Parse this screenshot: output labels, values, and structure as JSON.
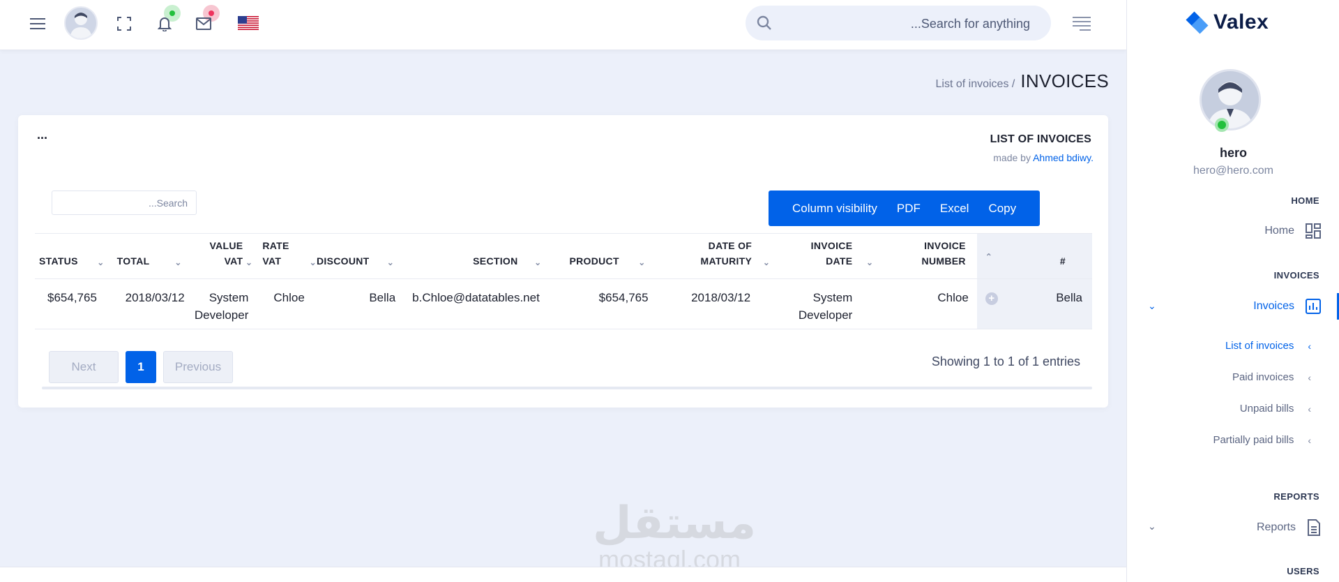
{
  "header": {
    "search_placeholder": "...Search for anything"
  },
  "breadcrumb": {
    "link": "List of invoices /",
    "title": "INVOICES"
  },
  "card": {
    "dots": "...",
    "title": "LIST OF INVOICES",
    "made_by_prefix": "made by",
    "made_by_author": "Ahmed bdiwy.",
    "table_search_placeholder": "...Search",
    "buttons": [
      "Column visibility",
      "PDF",
      "Excel",
      "Copy"
    ]
  },
  "table": {
    "headers": {
      "status": "STATUS",
      "total": "TOTAL",
      "value_vat_1": "VALUE",
      "value_vat_2": "VAT",
      "rate_vat_1": "RATE",
      "rate_vat_2": "VAT",
      "discount": "DISCOUNT",
      "section": "SECTION",
      "product": "PRODUCT",
      "maturity_1": "DATE OF",
      "maturity_2": "MATURITY",
      "inv_date_1": "INVOICE",
      "inv_date_2": "DATE",
      "inv_num_1": "INVOICE",
      "inv_num_2": "NUMBER",
      "index": "#"
    },
    "row": {
      "status": "$654,765",
      "total": "2018/03/12",
      "value_vat_1": "System",
      "value_vat_2": "Developer",
      "rate_vat": "Chloe",
      "discount": "Bella",
      "section": "b.Chloe@datatables.net",
      "product": "$654,765",
      "maturity": "2018/03/12",
      "inv_date_1": "System",
      "inv_date_2": "Developer",
      "inv_num": "Chloe",
      "expand": "+",
      "index": "Bella"
    }
  },
  "pagination": {
    "next": "Next",
    "current": "1",
    "previous": "Previous",
    "info": "Showing 1 to 1 of 1 entries"
  },
  "sidebar": {
    "brand": "Valex",
    "user_name": "hero",
    "user_email": "hero@hero.com",
    "sections": {
      "home": "HOME",
      "invoices": "INVOICES",
      "reports": "REPORTS",
      "users": "USERS"
    },
    "items": {
      "home": "Home",
      "invoices": "Invoices",
      "reports": "Reports"
    },
    "sub_items": [
      "List of invoices",
      "Paid invoices",
      "Unpaid bills",
      "Partially paid bills"
    ]
  },
  "watermark": {
    "arabic": "مستقل",
    "latin": "mostaql.com"
  },
  "colors": {
    "primary": "#0162e8",
    "background": "#ecf0fa",
    "online": "#22c03c",
    "notify_badge": "#22c03c",
    "mail_badge": "#ee335e"
  }
}
